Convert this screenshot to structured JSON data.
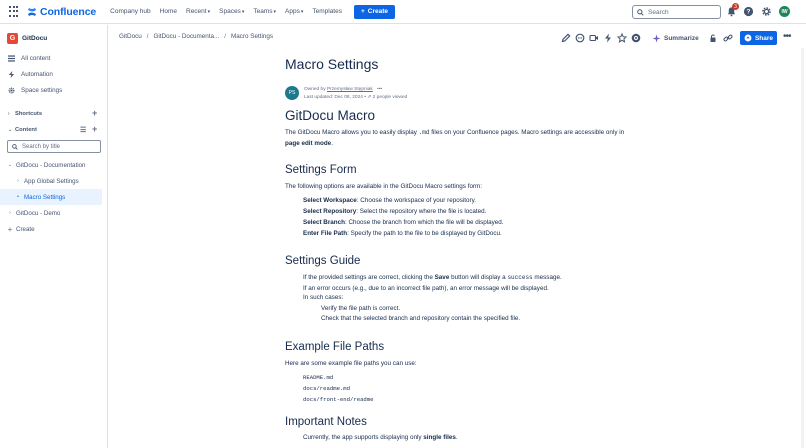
{
  "topnav": {
    "brand": "Confluence",
    "items": [
      {
        "label": "Company hub",
        "dropdown": false
      },
      {
        "label": "Home",
        "dropdown": false
      },
      {
        "label": "Recent",
        "dropdown": true
      },
      {
        "label": "Spaces",
        "dropdown": true
      },
      {
        "label": "Teams",
        "dropdown": true
      },
      {
        "label": "Apps",
        "dropdown": true
      },
      {
        "label": "Templates",
        "dropdown": false
      }
    ],
    "create_label": "Create",
    "search_placeholder": "Search",
    "notification_count": "3",
    "user_initials": "IW",
    "colors": {
      "brand_blue": "#0c66e4",
      "badge_red": "#c9372c"
    }
  },
  "sidebar": {
    "space_name": "GitDocu",
    "space_initial": "G",
    "items": [
      {
        "label": "All content",
        "icon": "list-icon"
      },
      {
        "label": "Automation",
        "icon": "lightning-icon"
      },
      {
        "label": "Space settings",
        "icon": "gear-icon"
      }
    ],
    "shortcuts_label": "Shortcuts",
    "content_label": "Content",
    "filter_placeholder": "Search by title",
    "tree": [
      {
        "label": "GitDocu - Documentation",
        "level": 0,
        "expanded": true
      },
      {
        "label": "App Global Settings",
        "level": 1,
        "expanded": false
      },
      {
        "label": "Macro Settings",
        "level": 1,
        "active": true
      },
      {
        "label": "GitDocu - Demo",
        "level": 0,
        "expanded": false
      }
    ],
    "create_label": "Create"
  },
  "breadcrumb": [
    "GitDocu",
    "GitDocu - Documenta...",
    "Macro Settings"
  ],
  "toolbar": {
    "summarize_label": "Summarize",
    "share_label": "Share"
  },
  "page": {
    "title": "Macro Settings",
    "owner_prefix": "Owned by",
    "owner": "Przemysław Stępniak",
    "avatar_initials": "PS",
    "last_updated": "Last updated: Dec 08, 2024 •",
    "viewers": "2 people viewed",
    "h_gitdocu": "GitDocu Macro",
    "intro_1": "The GitDocu Macro allows you to easily display",
    "intro_code": ".md",
    "intro_2": "files on your Confluence pages. Macro settings are accessible only in",
    "intro_bold": "page edit mode",
    "intro_end": ".",
    "h_form": "Settings Form",
    "form_intro": "The following options are available in the GitDocu Macro settings form:",
    "form_items": [
      {
        "bold": "Select Workspace",
        "text": ": Choose the workspace of your repository."
      },
      {
        "bold": "Select Repository",
        "text": ": Select the repository where the file is located."
      },
      {
        "bold": "Select Branch",
        "text": ": Choose the branch from which the file will be displayed."
      },
      {
        "bold": "Enter File Path",
        "text": ": Specify the path to the file to be displayed by GitDocu."
      }
    ],
    "h_guide": "Settings Guide",
    "guide_1a": "If the provided settings are correct, clicking the",
    "guide_1b": "Save",
    "guide_1c": "button will display a",
    "guide_1d": "success",
    "guide_1e": "message.",
    "guide_2": "If an error occurs (e.g., due to an incorrect file path), an error message will be displayed.",
    "guide_3": "In such cases:",
    "guide_4": "Verify the file path is correct.",
    "guide_5": "Check that the selected branch and repository contain the specified file.",
    "h_paths": "Example File Paths",
    "paths_intro": "Here are some example file paths you can use:",
    "paths": [
      "README.md",
      "docs/readme.md",
      "docs/front-end/readme"
    ],
    "h_notes": "Important Notes",
    "notes_1a": "Currently, the app supports displaying only",
    "notes_1b": "single files",
    "notes_1c": "."
  }
}
